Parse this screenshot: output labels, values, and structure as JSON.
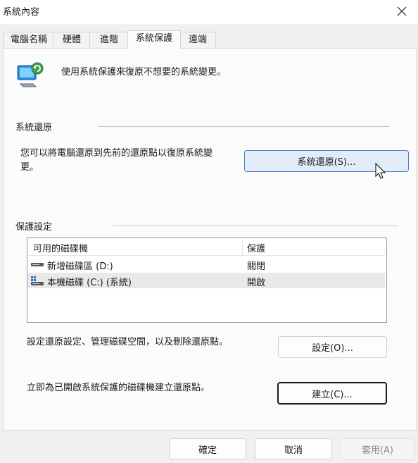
{
  "window": {
    "title": "系統內容"
  },
  "tabs": [
    {
      "label": "電腦名稱"
    },
    {
      "label": "硬體"
    },
    {
      "label": "進階"
    },
    {
      "label": "系統保護"
    },
    {
      "label": "遠端"
    }
  ],
  "active_tab": "系統保護",
  "intro": {
    "text": "使用系統保護來復原不想要的系統變更。"
  },
  "restore_section": {
    "title": "系統還原",
    "description_line1": "您可以將電腦還原到先前的還原點以復原系統變",
    "description_line2": "更。",
    "button_label": "系統還原(S)..."
  },
  "protection_section": {
    "title": "保護設定",
    "columns": [
      "可用的磁碟機",
      "保護"
    ],
    "drives": [
      {
        "name": "新增磁碟區 (D:)",
        "protection": "關閉",
        "icon": "drive-icon"
      },
      {
        "name": "本機磁碟 (C:) (系統)",
        "protection": "開啟",
        "icon": "system-drive-icon"
      }
    ],
    "configure_text": "設定還原設定、管理磁碟空間，以及刪除還原點。",
    "configure_button": "設定(O)...",
    "create_text": "立即為已開啟系統保護的磁碟機建立還原點。",
    "create_button": "建立(C)..."
  },
  "footer": {
    "ok": "確定",
    "cancel": "取消",
    "apply": "套用(A)"
  },
  "colors": {
    "accent": "#4a7fc4",
    "selected_row": "#e9e9e9",
    "panel": "#fbfbfb"
  }
}
